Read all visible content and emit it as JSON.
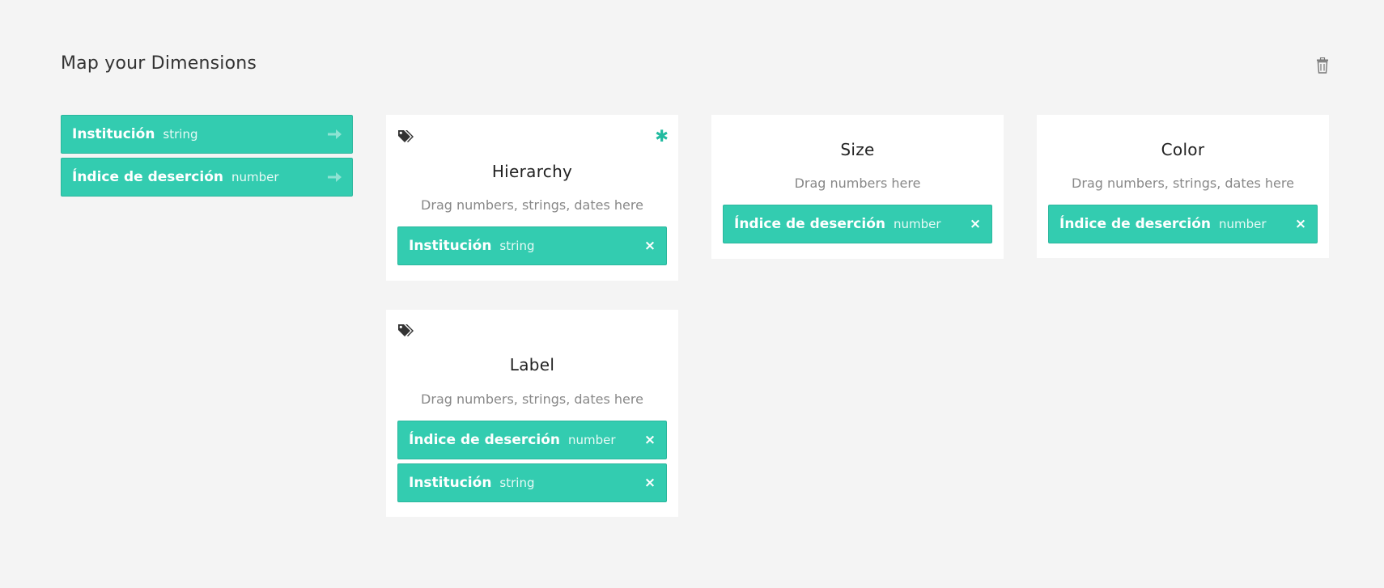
{
  "page": {
    "title": "Map your Dimensions"
  },
  "dimensions": [
    {
      "name": "Institución",
      "type": "string"
    },
    {
      "name": "Índice de deserción",
      "type": "number"
    }
  ],
  "cards": {
    "hierarchy": {
      "title": "Hierarchy",
      "hint": "Drag numbers, strings, dates here",
      "required_mark": "✱",
      "chips": [
        {
          "name": "Institución",
          "type": "string",
          "remove": "×"
        }
      ]
    },
    "size": {
      "title": "Size",
      "hint": "Drag numbers here",
      "chips": [
        {
          "name": "Índice de deserción",
          "type": "number",
          "remove": "×"
        }
      ]
    },
    "color": {
      "title": "Color",
      "hint": "Drag numbers, strings, dates here",
      "chips": [
        {
          "name": "Índice de deserción",
          "type": "number",
          "remove": "×"
        }
      ]
    },
    "label": {
      "title": "Label",
      "hint": "Drag numbers, strings, dates here",
      "chips": [
        {
          "name": "Índice de deserción",
          "type": "number",
          "remove": "×"
        },
        {
          "name": "Institución",
          "type": "string",
          "remove": "×"
        }
      ]
    }
  },
  "icons": {
    "trash": "trash-icon",
    "tag": "tags-icon",
    "arrow": "arrow-right-icon",
    "remove": "close-icon"
  },
  "colors": {
    "accent": "#33ccb0",
    "background": "#f4f4f4",
    "card": "#ffffff"
  }
}
